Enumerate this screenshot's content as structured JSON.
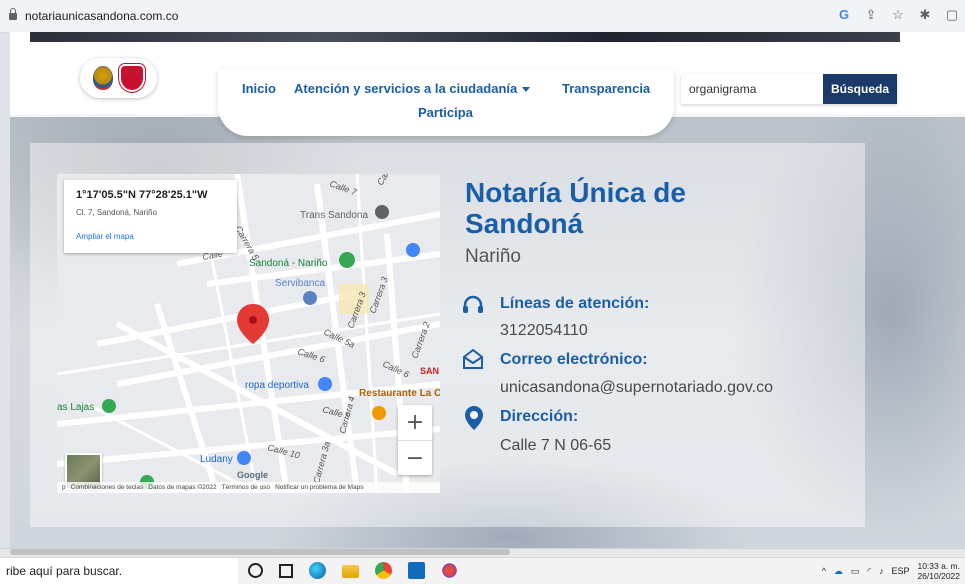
{
  "browser": {
    "url": "notariaunicasandona.com.co",
    "icons": [
      "google-icon",
      "share-icon",
      "star-icon",
      "extensions-icon",
      "sidebar-icon"
    ]
  },
  "nav": {
    "items": [
      "Inicio",
      "Atención y servicios a la ciudadanía",
      "Transparencia",
      "Participa"
    ]
  },
  "search": {
    "value": "organigrama",
    "button": "Búsqueda"
  },
  "map": {
    "coordinates": "1°17'05.5\"N 77°28'25.1\"W",
    "address": "Cl. 7, Sandoná, Nariño",
    "view_larger": "Ampliar el mapa",
    "zoom_in": "+",
    "zoom_out": "−",
    "labels": {
      "trans_sandona": "Trans Sandona",
      "sandona_narino": "Sandoná - Nariño",
      "servibanca": "Servibanca",
      "ropa_deportiva": "ropa deportiva",
      "restaurante": "Restaurante La C",
      "las_lajas": "as Lajas",
      "ludany": "Ludany",
      "san": "SAN",
      "calle7": "Calle 7",
      "calle6a": "Calle 6",
      "calle5a": "Calle 5a",
      "calle6b": "Calle 6",
      "calle6c": "Calle 6",
      "calle9": "Calle 9",
      "calle10": "Calle 10",
      "carrera3": "Carrera 3",
      "carrera2": "Carrera 2",
      "carrera4": "Carrera 4",
      "carrera3a": "Carrera 3a",
      "carrera5": "Carrera 5",
      "carrera_top": "Carrer",
      "calle_top": "Calle",
      "google": "Google",
      "keyboard": "Combinaciones de teclas",
      "mapdata": "Datos de mapas ©2022",
      "terms": "Términos de uso",
      "report": "Notificar un problema de Maps",
      "p_prefix": "p"
    }
  },
  "notary": {
    "title": "Notaría Única de Sandoná",
    "region": "Nariño",
    "phone_label": "Líneas de atención:",
    "phone": "3122054110",
    "email_label": "Correo electrónico:",
    "email": "unicasandona@supernotariado.gov.co",
    "address_label": "Dirección:",
    "address": "Calle 7 N 06-65"
  },
  "taskbar": {
    "search": "ribe aquí para buscar.",
    "language": "ESP",
    "time": "10:33 a. m.",
    "date": "26/10/2022"
  },
  "colors": {
    "brand_blue": "#1a5ea8",
    "button_dark": "#1b3a6b",
    "pin_red": "#e53935",
    "poi_green": "#34a853",
    "poi_blue": "#4285f4"
  }
}
